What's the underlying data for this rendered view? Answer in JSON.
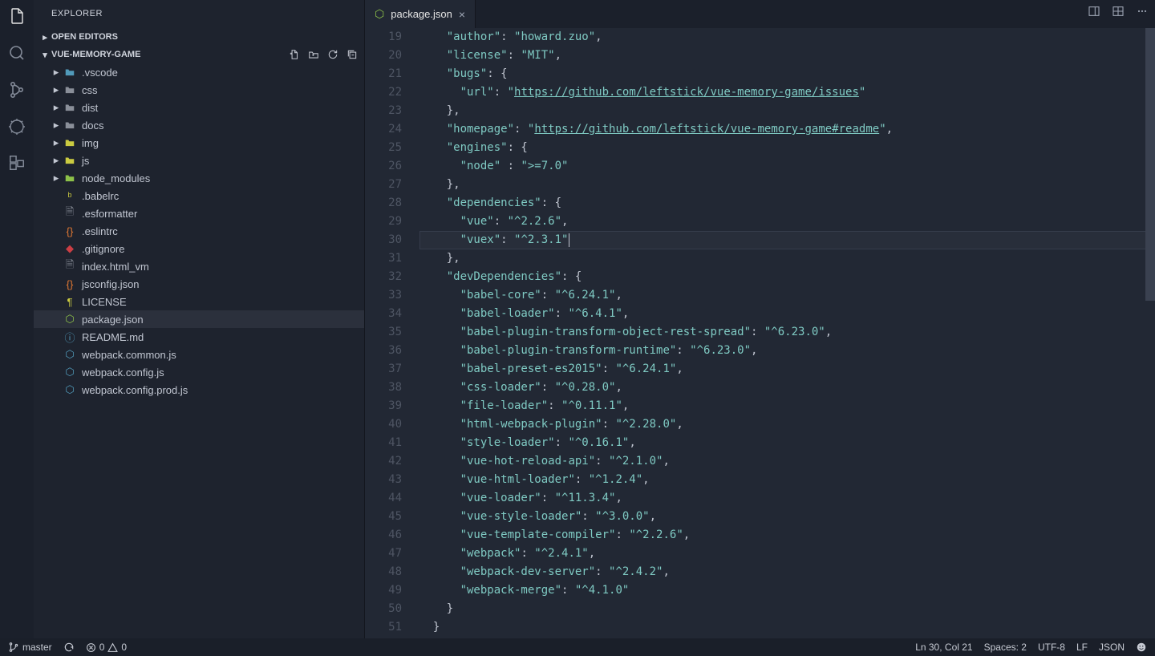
{
  "sidebar": {
    "title": "EXPLORER",
    "open_editors": "OPEN EDITORS",
    "project": "VUE-MEMORY-GAME",
    "folders": [
      {
        "label": ".vscode",
        "color": "#519aba"
      },
      {
        "label": "css",
        "color": "#8a8f99"
      },
      {
        "label": "dist",
        "color": "#8a8f99"
      },
      {
        "label": "docs",
        "color": "#8a8f99"
      },
      {
        "label": "img",
        "color": "#cbcb41"
      },
      {
        "label": "js",
        "color": "#cbcb41"
      },
      {
        "label": "node_modules",
        "color": "#8dc149"
      }
    ],
    "files": [
      {
        "label": ".babelrc",
        "glyph": "ᵇ",
        "gcolor": "#cbcb41"
      },
      {
        "label": ".esformatter",
        "glyph": "🗎",
        "gcolor": "#8a8f99"
      },
      {
        "label": ".eslintrc",
        "glyph": "{}",
        "gcolor": "#e37933"
      },
      {
        "label": ".gitignore",
        "glyph": "◆",
        "gcolor": "#cc3e44"
      },
      {
        "label": "index.html_vm",
        "glyph": "🗎",
        "gcolor": "#8a8f99"
      },
      {
        "label": "jsconfig.json",
        "glyph": "{}",
        "gcolor": "#e37933"
      },
      {
        "label": "LICENSE",
        "glyph": "¶",
        "gcolor": "#cbcb41"
      },
      {
        "label": "package.json",
        "glyph": "⬡",
        "gcolor": "#8dc149",
        "selected": true
      },
      {
        "label": "README.md",
        "glyph": "ⓘ",
        "gcolor": "#519aba"
      },
      {
        "label": "webpack.common.js",
        "glyph": "⬡",
        "gcolor": "#519aba"
      },
      {
        "label": "webpack.config.js",
        "glyph": "⬡",
        "gcolor": "#519aba"
      },
      {
        "label": "webpack.config.prod.js",
        "glyph": "⬡",
        "gcolor": "#519aba"
      }
    ]
  },
  "tab": {
    "label": "package.json",
    "glyph": "⬡",
    "gcolor": "#8dc149"
  },
  "code": {
    "start": 19,
    "highlight": 30,
    "lines": [
      [
        [
          "    ",
          ""
        ],
        [
          "\"author\"",
          "k"
        ],
        [
          ": ",
          "p"
        ],
        [
          "\"howard.zuo\"",
          "k"
        ],
        [
          ",",
          "p"
        ]
      ],
      [
        [
          "    ",
          ""
        ],
        [
          "\"license\"",
          "k"
        ],
        [
          ": ",
          "p"
        ],
        [
          "\"MIT\"",
          "k"
        ],
        [
          ",",
          "p"
        ]
      ],
      [
        [
          "    ",
          ""
        ],
        [
          "\"bugs\"",
          "k"
        ],
        [
          ": {",
          "p"
        ]
      ],
      [
        [
          "      ",
          ""
        ],
        [
          "\"url\"",
          "k"
        ],
        [
          ": ",
          "p"
        ],
        [
          "\"",
          "k"
        ],
        [
          "https://github.com/leftstick/vue-memory-game/issues",
          "u"
        ],
        [
          "\"",
          "k"
        ]
      ],
      [
        [
          "    ",
          ""
        ],
        [
          "},",
          "p"
        ]
      ],
      [
        [
          "    ",
          ""
        ],
        [
          "\"homepage\"",
          "k"
        ],
        [
          ": ",
          "p"
        ],
        [
          "\"",
          "k"
        ],
        [
          "https://github.com/leftstick/vue-memory-game#readme",
          "u"
        ],
        [
          "\"",
          "k"
        ],
        [
          ",",
          "p"
        ]
      ],
      [
        [
          "    ",
          ""
        ],
        [
          "\"engines\"",
          "k"
        ],
        [
          ": {",
          "p"
        ]
      ],
      [
        [
          "      ",
          ""
        ],
        [
          "\"node\"",
          "k"
        ],
        [
          " : ",
          "p"
        ],
        [
          "\">=7.0\"",
          "k"
        ]
      ],
      [
        [
          "    ",
          ""
        ],
        [
          "},",
          "p"
        ]
      ],
      [
        [
          "    ",
          ""
        ],
        [
          "\"dependencies\"",
          "k"
        ],
        [
          ": {",
          "p"
        ]
      ],
      [
        [
          "      ",
          ""
        ],
        [
          "\"vue\"",
          "k"
        ],
        [
          ": ",
          "p"
        ],
        [
          "\"^2.2.6\"",
          "k"
        ],
        [
          ",",
          "p"
        ]
      ],
      [
        [
          "      ",
          ""
        ],
        [
          "\"vuex\"",
          "k"
        ],
        [
          ": ",
          "p"
        ],
        [
          "\"^2.3.1\"",
          "k"
        ]
      ],
      [
        [
          "    ",
          ""
        ],
        [
          "},",
          "p"
        ]
      ],
      [
        [
          "    ",
          ""
        ],
        [
          "\"devDependencies\"",
          "k"
        ],
        [
          ": {",
          "p"
        ]
      ],
      [
        [
          "      ",
          ""
        ],
        [
          "\"babel-core\"",
          "k"
        ],
        [
          ": ",
          "p"
        ],
        [
          "\"^6.24.1\"",
          "k"
        ],
        [
          ",",
          "p"
        ]
      ],
      [
        [
          "      ",
          ""
        ],
        [
          "\"babel-loader\"",
          "k"
        ],
        [
          ": ",
          "p"
        ],
        [
          "\"^6.4.1\"",
          "k"
        ],
        [
          ",",
          "p"
        ]
      ],
      [
        [
          "      ",
          ""
        ],
        [
          "\"babel-plugin-transform-object-rest-spread\"",
          "k"
        ],
        [
          ": ",
          "p"
        ],
        [
          "\"^6.23.0\"",
          "k"
        ],
        [
          ",",
          "p"
        ]
      ],
      [
        [
          "      ",
          ""
        ],
        [
          "\"babel-plugin-transform-runtime\"",
          "k"
        ],
        [
          ": ",
          "p"
        ],
        [
          "\"^6.23.0\"",
          "k"
        ],
        [
          ",",
          "p"
        ]
      ],
      [
        [
          "      ",
          ""
        ],
        [
          "\"babel-preset-es2015\"",
          "k"
        ],
        [
          ": ",
          "p"
        ],
        [
          "\"^6.24.1\"",
          "k"
        ],
        [
          ",",
          "p"
        ]
      ],
      [
        [
          "      ",
          ""
        ],
        [
          "\"css-loader\"",
          "k"
        ],
        [
          ": ",
          "p"
        ],
        [
          "\"^0.28.0\"",
          "k"
        ],
        [
          ",",
          "p"
        ]
      ],
      [
        [
          "      ",
          ""
        ],
        [
          "\"file-loader\"",
          "k"
        ],
        [
          ": ",
          "p"
        ],
        [
          "\"^0.11.1\"",
          "k"
        ],
        [
          ",",
          "p"
        ]
      ],
      [
        [
          "      ",
          ""
        ],
        [
          "\"html-webpack-plugin\"",
          "k"
        ],
        [
          ": ",
          "p"
        ],
        [
          "\"^2.28.0\"",
          "k"
        ],
        [
          ",",
          "p"
        ]
      ],
      [
        [
          "      ",
          ""
        ],
        [
          "\"style-loader\"",
          "k"
        ],
        [
          ": ",
          "p"
        ],
        [
          "\"^0.16.1\"",
          "k"
        ],
        [
          ",",
          "p"
        ]
      ],
      [
        [
          "      ",
          ""
        ],
        [
          "\"vue-hot-reload-api\"",
          "k"
        ],
        [
          ": ",
          "p"
        ],
        [
          "\"^2.1.0\"",
          "k"
        ],
        [
          ",",
          "p"
        ]
      ],
      [
        [
          "      ",
          ""
        ],
        [
          "\"vue-html-loader\"",
          "k"
        ],
        [
          ": ",
          "p"
        ],
        [
          "\"^1.2.4\"",
          "k"
        ],
        [
          ",",
          "p"
        ]
      ],
      [
        [
          "      ",
          ""
        ],
        [
          "\"vue-loader\"",
          "k"
        ],
        [
          ": ",
          "p"
        ],
        [
          "\"^11.3.4\"",
          "k"
        ],
        [
          ",",
          "p"
        ]
      ],
      [
        [
          "      ",
          ""
        ],
        [
          "\"vue-style-loader\"",
          "k"
        ],
        [
          ": ",
          "p"
        ],
        [
          "\"^3.0.0\"",
          "k"
        ],
        [
          ",",
          "p"
        ]
      ],
      [
        [
          "      ",
          ""
        ],
        [
          "\"vue-template-compiler\"",
          "k"
        ],
        [
          ": ",
          "p"
        ],
        [
          "\"^2.2.6\"",
          "k"
        ],
        [
          ",",
          "p"
        ]
      ],
      [
        [
          "      ",
          ""
        ],
        [
          "\"webpack\"",
          "k"
        ],
        [
          ": ",
          "p"
        ],
        [
          "\"^2.4.1\"",
          "k"
        ],
        [
          ",",
          "p"
        ]
      ],
      [
        [
          "      ",
          ""
        ],
        [
          "\"webpack-dev-server\"",
          "k"
        ],
        [
          ": ",
          "p"
        ],
        [
          "\"^2.4.2\"",
          "k"
        ],
        [
          ",",
          "p"
        ]
      ],
      [
        [
          "      ",
          ""
        ],
        [
          "\"webpack-merge\"",
          "k"
        ],
        [
          ": ",
          "p"
        ],
        [
          "\"^4.1.0\"",
          "k"
        ]
      ],
      [
        [
          "    ",
          ""
        ],
        [
          "}",
          "p"
        ]
      ],
      [
        [
          "  ",
          ""
        ],
        [
          "}",
          "p"
        ]
      ],
      [
        [
          "",
          ""
        ]
      ]
    ]
  },
  "status": {
    "branch": "master",
    "errors": "0",
    "warnings": "0",
    "lncol": "Ln 30, Col 21",
    "spaces": "Spaces: 2",
    "enc": "UTF-8",
    "eol": "LF",
    "lang": "JSON"
  }
}
